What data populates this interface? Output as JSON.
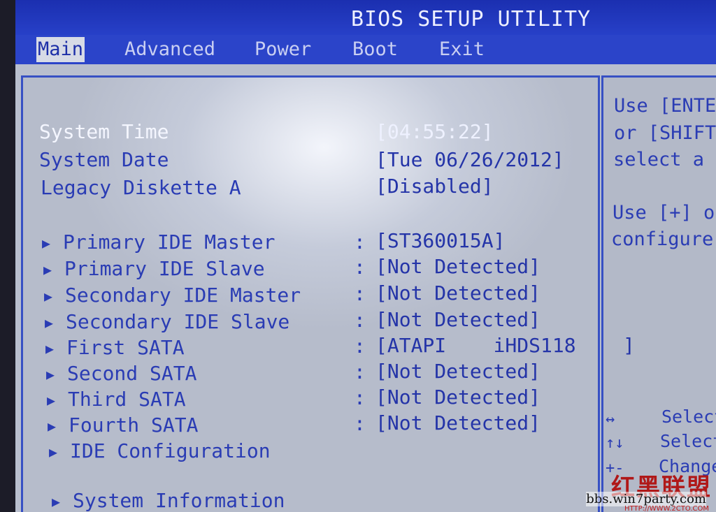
{
  "title": "BIOS SETUP UTILITY",
  "menu": {
    "items": [
      {
        "label": "Main",
        "active": true
      },
      {
        "label": "Advanced",
        "active": false
      },
      {
        "label": "Power",
        "active": false
      },
      {
        "label": "Boot",
        "active": false
      },
      {
        "label": "Exit",
        "active": false
      }
    ]
  },
  "settings": {
    "system_time": {
      "label": "System Time",
      "value": "[04:55:22]"
    },
    "system_date": {
      "label": "System Date",
      "value": "[Tue 06/26/2012]"
    },
    "legacy_diskette": {
      "label": "Legacy Diskette A",
      "value": "[Disabled]"
    }
  },
  "devices": [
    {
      "label": "Primary IDE Master",
      "value": "[ST360015A]"
    },
    {
      "label": "Primary IDE Slave",
      "value": "[Not Detected]"
    },
    {
      "label": "Secondary IDE Master",
      "value": "[Not Detected]"
    },
    {
      "label": "Secondary IDE Slave",
      "value": "[Not Detected]"
    },
    {
      "label": "First SATA",
      "value": "[ATAPI    iHDS118    ]"
    },
    {
      "label": "Second SATA",
      "value": "[Not Detected]"
    },
    {
      "label": "Third SATA",
      "value": "[Not Detected]"
    },
    {
      "label": "Fourth SATA",
      "value": "[Not Detected]"
    }
  ],
  "submenus": {
    "ide_configuration": "IDE Configuration",
    "system_information": "System Information"
  },
  "separator": ":",
  "arrow_glyph": "▶",
  "help": {
    "lines": [
      "Use [ENTER",
      "or [SHIFT-",
      "select a f",
      "Use [+] or",
      "configure s"
    ]
  },
  "keys": [
    {
      "key": "↔",
      "desc": "Select"
    },
    {
      "key": "↑↓",
      "desc": "Select"
    },
    {
      "key": "+-",
      "desc": "Change"
    }
  ],
  "watermark": {
    "cn": "红黑联盟",
    "url": "bbs.win7party.com",
    "url2": "HTTP://WWW.2CTO.COM"
  },
  "colors": {
    "bios_blue": "#2b44c9",
    "panel_gray": "#b9bfce",
    "text_blue": "#2a3cb4",
    "highlight": "#f4f6ff"
  }
}
